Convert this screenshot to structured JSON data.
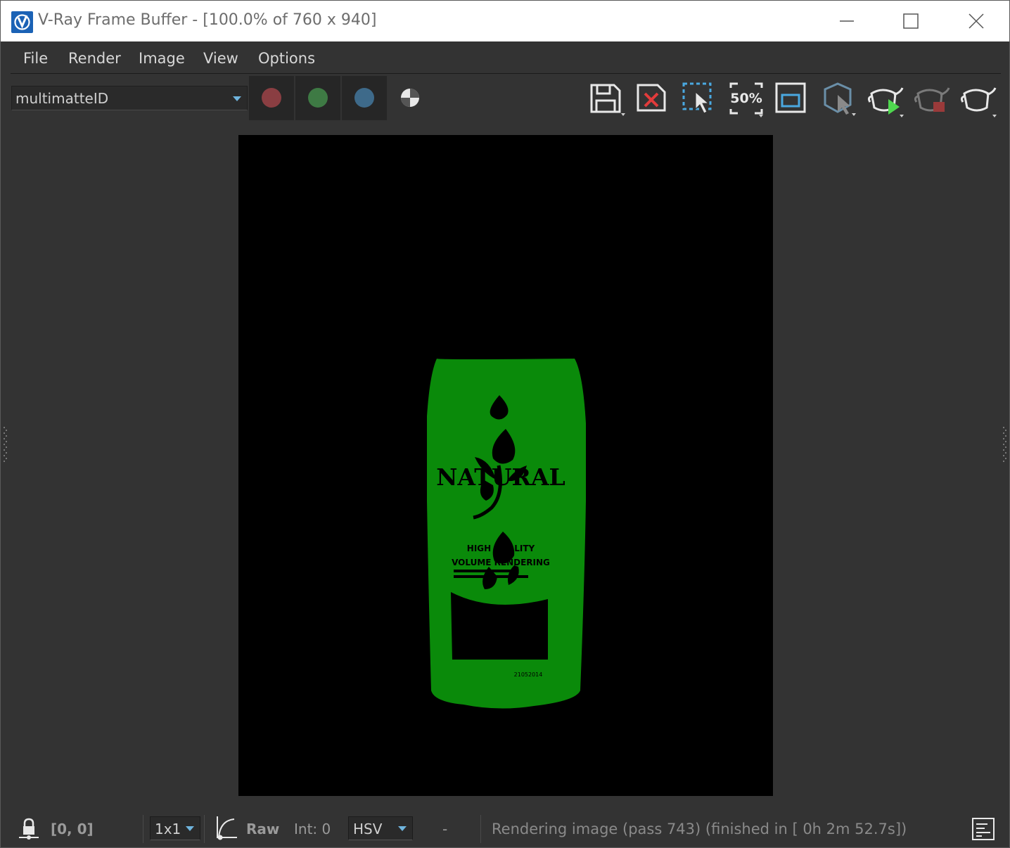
{
  "window": {
    "title": "V-Ray Frame Buffer - [100.0% of 760 x 940]"
  },
  "menu": {
    "items": [
      "File",
      "Render",
      "Image",
      "View",
      "Options"
    ]
  },
  "toolbar": {
    "channel": "multimatteID",
    "channel_buttons": [
      {
        "name": "red-channel",
        "color": "#8a3e42"
      },
      {
        "name": "green-channel",
        "color": "#3e7a44"
      },
      {
        "name": "blue-channel",
        "color": "#3e6a8a"
      }
    ],
    "zoom_icon_text": "50%",
    "icons": [
      "save-icon",
      "clear-image-icon",
      "region-render-icon",
      "zoom-50-icon",
      "render-region-frame-icon",
      "track-mouse-icon",
      "start-render-icon",
      "stop-render-icon",
      "render-last-icon"
    ]
  },
  "render": {
    "label_text_1": "NATURAL",
    "label_text_2": "HIGH QUALITY",
    "label_text_3": "VOLUME RENDERING",
    "date_code": "21052014",
    "matte_color": "#0a8a0a"
  },
  "statusbar": {
    "coords": "[0, 0]",
    "sample_size": "1x1",
    "raw": "Raw",
    "int": "Int: 0",
    "color_mode": "HSV",
    "dash": "-",
    "message": "Rendering image (pass 743) (finished in [ 0h  2m 52.7s])"
  }
}
